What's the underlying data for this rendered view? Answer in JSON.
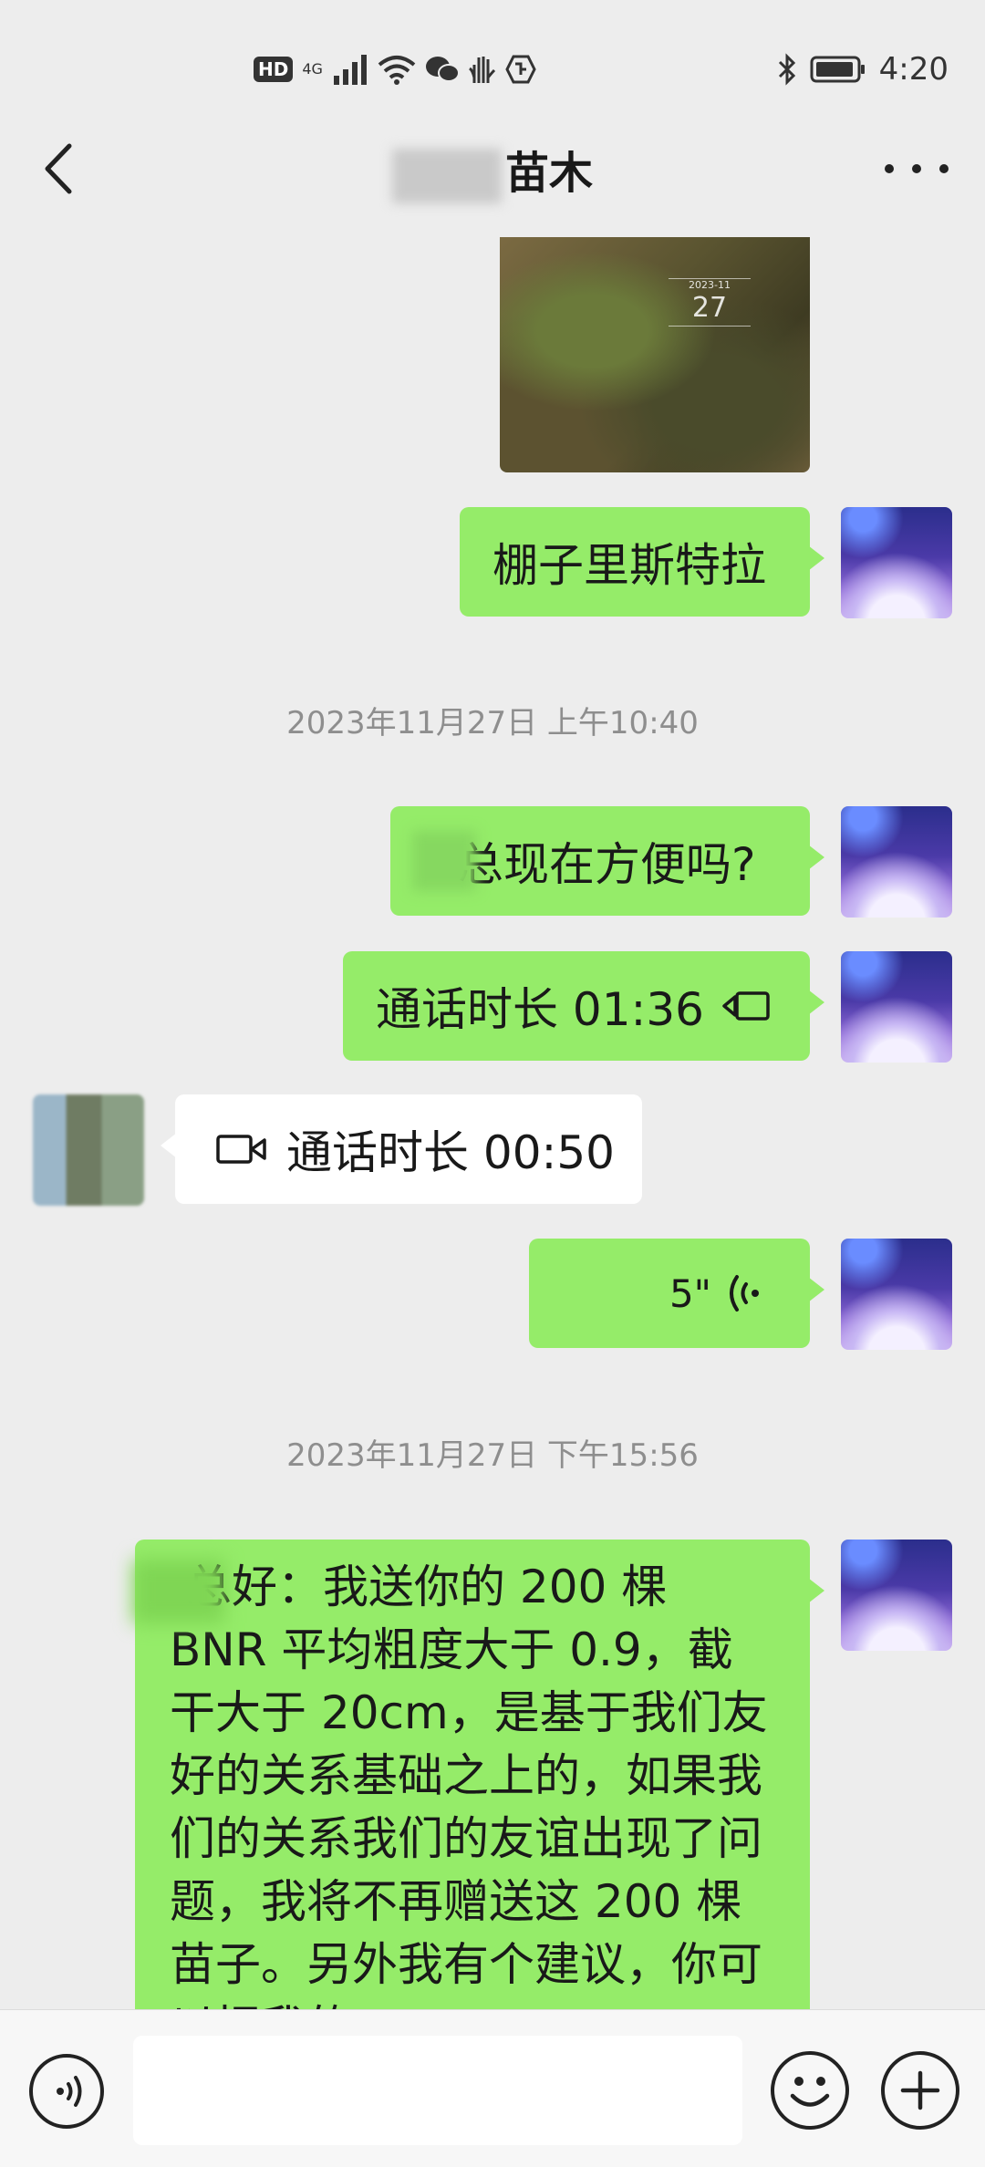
{
  "status_bar": {
    "hd": "HD",
    "network": "4G",
    "time": "4:20"
  },
  "header": {
    "title": "苗木"
  },
  "messages": {
    "m1_text": "棚子里斯特拉",
    "ts1": "2023年11月27日 上午10:40",
    "m2_text": "总现在方便吗?",
    "m3_text": "通话时长 01:36",
    "m4_text": "通话时长 00:50",
    "m5_duration": "5\"",
    "ts2": "2023年11月27日 下午15:56",
    "m6_text": "总好：我送你的 200 棵 BNR 平均粗度大于 0.9，截干大于 20cm，是基于我们友好的关系基础之上的，如果我们的关系我们的友谊出现了问题，我将不再赠送这 200 棵苗子。另外我有个建议，你可以把我的"
  },
  "photo_stamp": {
    "date": "2023-11",
    "day": "27"
  },
  "colors": {
    "bg": "#ededed",
    "my_bubble": "#95ec69",
    "their_bubble": "#ffffff",
    "timestamp": "#8e8e8e"
  },
  "icons": [
    "back-arrow-icon",
    "more-dots-icon",
    "video-call-icon",
    "voice-wave-icon",
    "voice-input-icon",
    "emoji-icon",
    "plus-icon",
    "bluetooth-icon",
    "battery-icon",
    "wifi-icon",
    "signal-icon",
    "wechat-icon",
    "hand-icon",
    "shield-icon"
  ]
}
